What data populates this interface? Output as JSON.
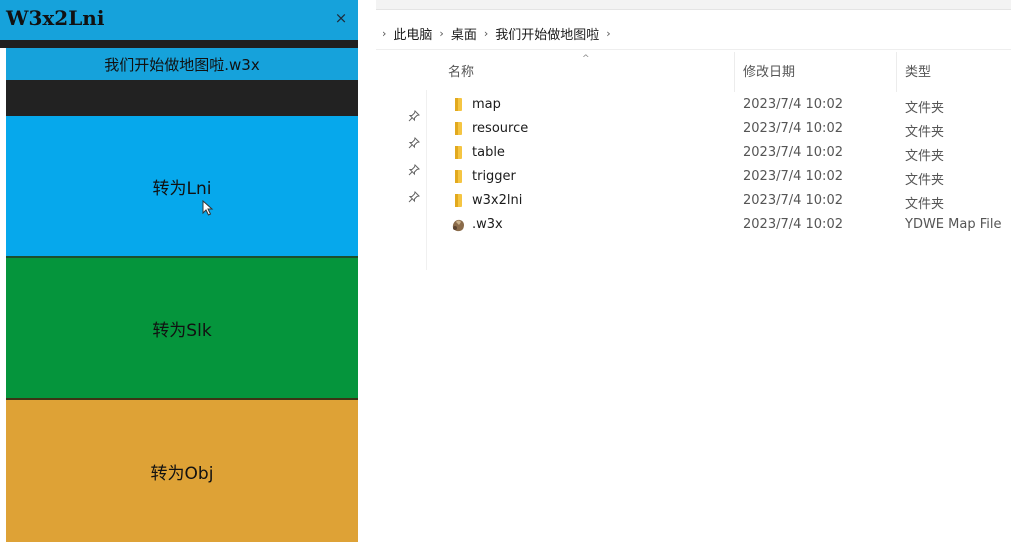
{
  "app": {
    "title": "W3x2Lni",
    "close_glyph": "×",
    "file_name": "我们开始做地图啦.w3x",
    "buttons": {
      "lni": "转为Lni",
      "slk": "转为Slk",
      "obj": "转为Obj"
    },
    "colors": {
      "titlebar": "#16a2db",
      "lni": "#06a8ec",
      "slk": "#05953c",
      "obj": "#dea236"
    }
  },
  "explorer": {
    "breadcrumb": [
      "此电脑",
      "桌面",
      "我们开始做地图啦"
    ],
    "columns": {
      "name": "名称",
      "date": "修改日期",
      "type": "类型"
    },
    "rows": [
      {
        "icon": "folder-icon",
        "name": "map",
        "date": "2023/7/4 10:02",
        "type": "文件夹",
        "pinned": true
      },
      {
        "icon": "folder-icon",
        "name": "resource",
        "date": "2023/7/4 10:02",
        "type": "文件夹",
        "pinned": true
      },
      {
        "icon": "folder-icon",
        "name": "table",
        "date": "2023/7/4 10:02",
        "type": "文件夹",
        "pinned": true
      },
      {
        "icon": "folder-icon",
        "name": "trigger",
        "date": "2023/7/4 10:02",
        "type": "文件夹",
        "pinned": true
      },
      {
        "icon": "folder-icon",
        "name": "w3x2lni",
        "date": "2023/7/4 10:02",
        "type": "文件夹",
        "pinned": false
      },
      {
        "icon": "map-file-icon",
        "name": ".w3x",
        "date": "2023/7/4 10:02",
        "type": "YDWE Map File",
        "pinned": false
      }
    ]
  }
}
